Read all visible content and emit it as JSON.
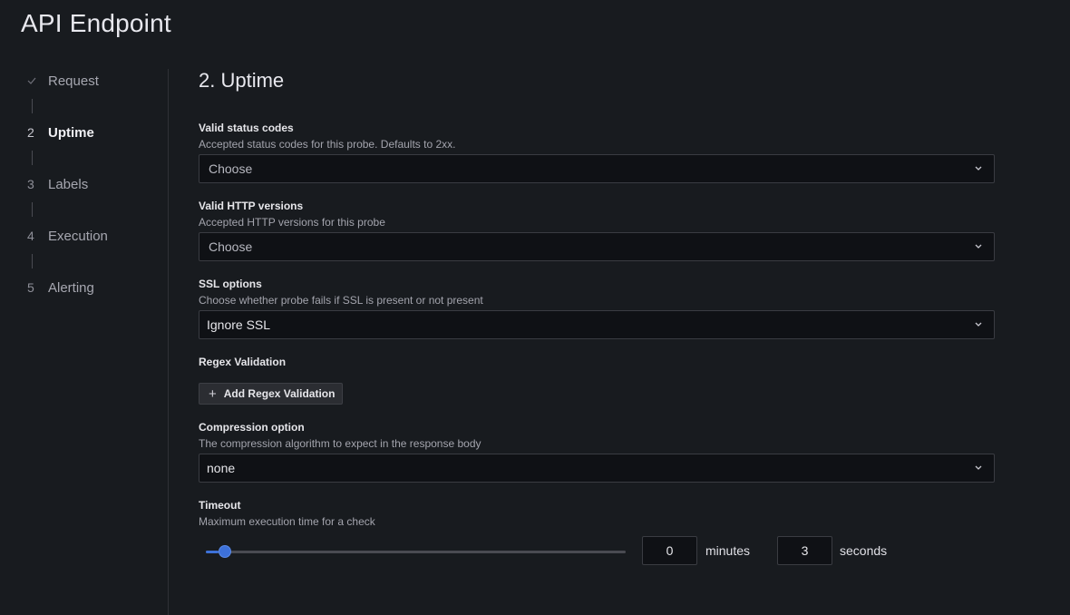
{
  "page": {
    "title": "API Endpoint"
  },
  "stepper": {
    "items": [
      {
        "number": "",
        "icon": "check-icon",
        "label": "Request",
        "state": "done"
      },
      {
        "number": "2",
        "label": "Uptime",
        "state": "active"
      },
      {
        "number": "3",
        "label": "Labels",
        "state": "pending"
      },
      {
        "number": "4",
        "label": "Execution",
        "state": "pending"
      },
      {
        "number": "5",
        "label": "Alerting",
        "state": "pending"
      }
    ]
  },
  "section": {
    "title": "2. Uptime"
  },
  "fields": {
    "status_codes": {
      "label": "Valid status codes",
      "description": "Accepted status codes for this probe. Defaults to 2xx.",
      "value": "Choose"
    },
    "http_versions": {
      "label": "Valid HTTP versions",
      "description": "Accepted HTTP versions for this probe",
      "value": "Choose"
    },
    "ssl": {
      "label": "SSL options",
      "description": "Choose whether probe fails if SSL is present or not present",
      "value": "Ignore SSL"
    },
    "regex": {
      "label": "Regex Validation",
      "button_label": "Add Regex Validation"
    },
    "compression": {
      "label": "Compression option",
      "description": "The compression algorithm to expect in the response body",
      "value": "none"
    },
    "timeout": {
      "label": "Timeout",
      "description": "Maximum execution time for a check",
      "slider_fraction": 0.03,
      "minutes": "0",
      "minutes_label": "minutes",
      "seconds": "3",
      "seconds_label": "seconds"
    }
  },
  "colors": {
    "accent": "#3d71d9",
    "background": "#181b1f",
    "input_bg": "#0f1115"
  }
}
